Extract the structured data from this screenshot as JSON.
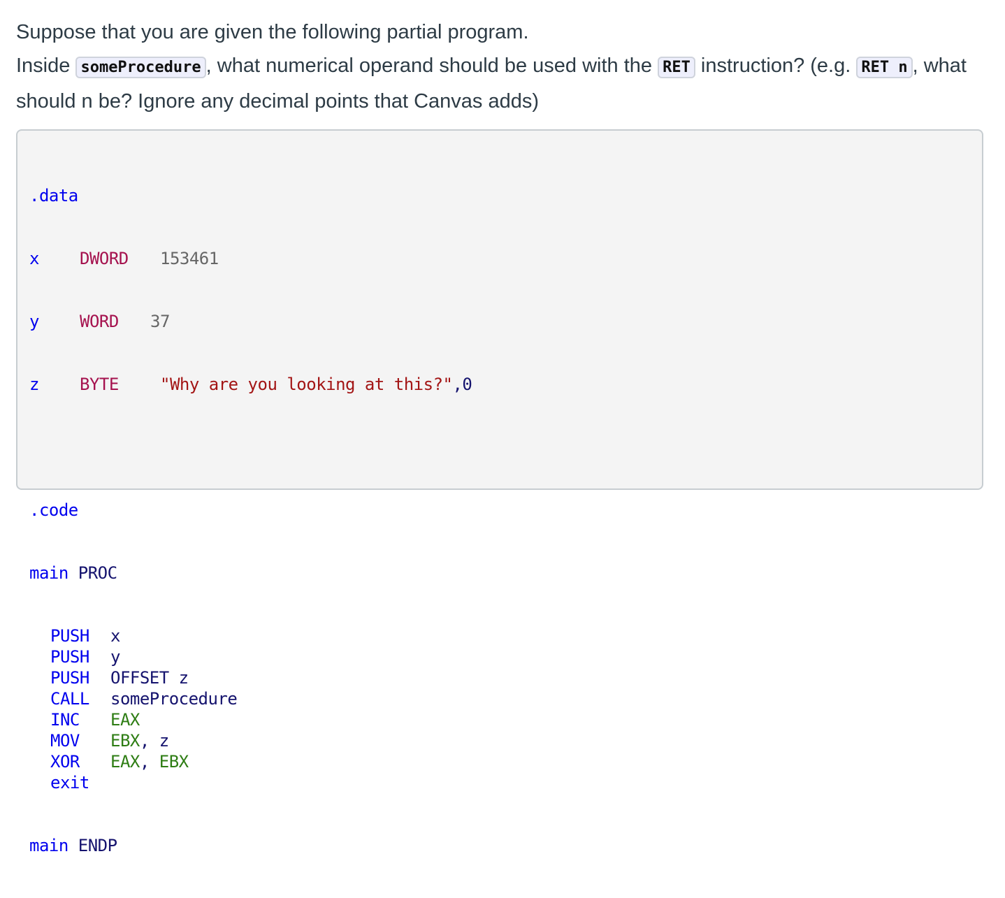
{
  "question": {
    "line1": "Suppose that you are given the following partial program.",
    "line2_pre": "Inside ",
    "line2_code1": "someProcedure",
    "line2_mid": ", what numerical operand should be used with the ",
    "line2_code2": "RET",
    "line2_post": " instruction? (e.g. ",
    "line2_code3": "RET n",
    "line2_end": ", what should n be? Ignore any decimal points that Canvas adds)"
  },
  "code": {
    "data_directive": ".data",
    "data_vars": [
      {
        "name": "x",
        "type": "DWORD",
        "value": "153461"
      },
      {
        "name": "y",
        "type": "WORD",
        "value": "37"
      },
      {
        "name": "z",
        "type": "BYTE",
        "value": "\"Why are you looking at this?\"",
        "suffix": ",0"
      }
    ],
    "code_directive": ".code",
    "proc_start": {
      "name": "main",
      "keyword": "PROC"
    },
    "instructions": [
      {
        "op": "PUSH",
        "args": [
          {
            "t": "x",
            "k": "id"
          }
        ]
      },
      {
        "op": "PUSH",
        "args": [
          {
            "t": "y",
            "k": "id"
          }
        ]
      },
      {
        "op": "PUSH",
        "args": [
          {
            "t": "OFFSET z",
            "k": "id"
          }
        ]
      },
      {
        "op": "CALL",
        "args": [
          {
            "t": "someProcedure",
            "k": "id"
          }
        ]
      },
      {
        "op": "INC",
        "args": [
          {
            "t": "EAX",
            "k": "reg"
          }
        ]
      },
      {
        "op": "MOV",
        "args": [
          {
            "t": "EBX",
            "k": "reg"
          },
          {
            "t": ", z",
            "k": "id"
          }
        ]
      },
      {
        "op": "XOR",
        "args": [
          {
            "t": "EAX",
            "k": "reg"
          },
          {
            "t": ", ",
            "k": "id"
          },
          {
            "t": "EBX",
            "k": "reg"
          }
        ]
      },
      {
        "op": "exit",
        "args": []
      }
    ],
    "proc_end": {
      "name": "main",
      "keyword": "ENDP"
    }
  }
}
